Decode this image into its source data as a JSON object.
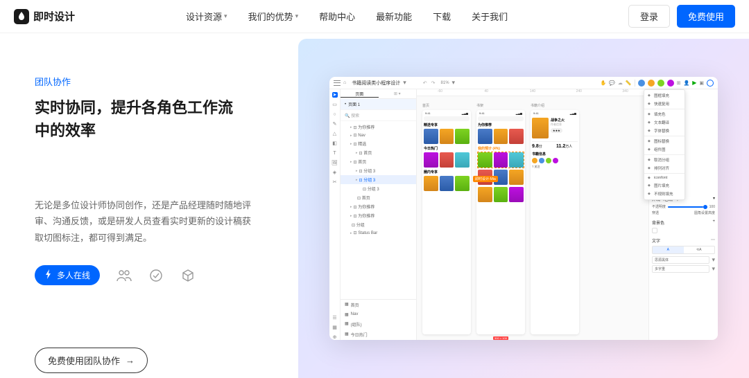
{
  "header": {
    "logo_text": "即时设计",
    "nav": [
      {
        "label": "设计资源",
        "caret": true
      },
      {
        "label": "我们的优势",
        "caret": true
      },
      {
        "label": "帮助中心",
        "caret": false
      },
      {
        "label": "最新功能",
        "caret": false
      },
      {
        "label": "下载",
        "caret": false
      },
      {
        "label": "关于我们",
        "caret": false
      }
    ],
    "login": "登录",
    "signup": "免费使用"
  },
  "hero": {
    "overline": "团队协作",
    "headline": "实时协同，提升各角色工作流中的效率",
    "description": "无论是多位设计师协同创作，还是产品经理随时随地评审、沟通反馈，或是研发人员查看实时更新的设计稿获取切图标注，都可得到满足。",
    "pill": "多人在线",
    "cta": "免费使用团队协作"
  },
  "editor": {
    "title": "书籍阅读类小程序设计",
    "zoom": "81%",
    "tabs": {
      "a": "页面",
      "b": "图层"
    },
    "page_label": "页面 1",
    "search_placeholder": "搜索",
    "rulers": [
      "-60",
      "40",
      "140",
      "240",
      "340"
    ],
    "layers": [
      {
        "label": "为你推荐",
        "indent": 1,
        "chev": true
      },
      {
        "label": "Nav",
        "indent": 1,
        "chev": true
      },
      {
        "label": "精选",
        "indent": 1,
        "chev": true
      },
      {
        "label": "首页",
        "indent": 2,
        "chev": true
      },
      {
        "label": "首页",
        "indent": 1,
        "chev": true
      },
      {
        "label": "分组 3",
        "indent": 2,
        "chev": true
      },
      {
        "label": "分组 3",
        "indent": 2,
        "chev": true,
        "sel": true
      },
      {
        "label": "分组 3",
        "indent": 3,
        "chev": false
      },
      {
        "label": "首页",
        "indent": 2,
        "chev": false
      },
      {
        "label": "为你推荐",
        "indent": 1,
        "chev": true
      },
      {
        "label": "为你推荐",
        "indent": 1,
        "chev": true
      },
      {
        "label": "分组",
        "indent": 1,
        "chev": false
      },
      {
        "label": "Status Bar",
        "indent": 1,
        "chev": true
      }
    ],
    "bottom_layers": [
      {
        "label": "首页"
      },
      {
        "label": "Nav"
      },
      {
        "label": "(组队)"
      },
      {
        "label": "今日热门"
      }
    ],
    "artboards": {
      "a": {
        "label": "首页",
        "time": "9:41",
        "head1": "精选专享",
        "head2": "今日热门",
        "head3": "圈内专享"
      },
      "b": {
        "label": "书架",
        "time": "9:41",
        "head1": "为你推荐",
        "head2": "我的预计 (4%)"
      },
      "c": {
        "label": "书籍介绍",
        "time": "9:41",
        "book_title": "战争之火",
        "author": "作者信息",
        "stat1": "9.8",
        "stat1_unit": "分",
        "stat2": "11.2",
        "stat2_unit": "万人",
        "about": "书籍信息",
        "follow": "关注"
      }
    },
    "cursor_tag": "即时设计-Mia",
    "dim_tag": "300 × 100",
    "context_menu": [
      "图框填充",
      "快速复用",
      "|",
      "填充色",
      "文本翻译",
      "字体替换",
      "|",
      "图标替换",
      "组件图",
      "|",
      "取消分组",
      "排列对齐",
      "|",
      "iconfont",
      "图片填充",
      "不规则填充"
    ],
    "props": {
      "section_opacity": "外观（已统一）",
      "opacity_label": "不透明度",
      "opacity_val": "100",
      "section_bg": "背景色",
      "section_text": "文字",
      "text_tab_a": "A",
      "text_tab_b": "⟲A",
      "font": "思源黑体",
      "weight": "多字重",
      "pass_label": "穿透",
      "corner_label": "圆角设置高度"
    }
  }
}
